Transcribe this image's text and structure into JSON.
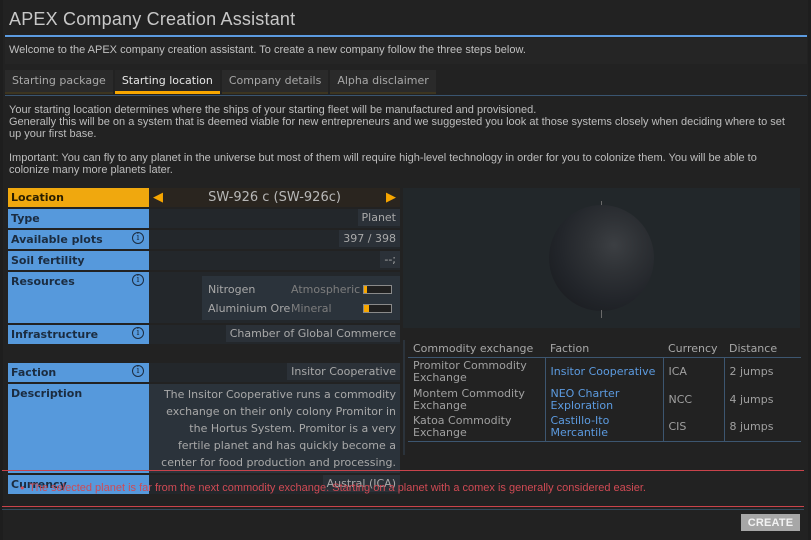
{
  "window": {
    "title": "APEX Company Creation Assistant",
    "welcome": "Welcome to the APEX company creation assistant. To create a new company follow the three steps below."
  },
  "tabs": [
    {
      "label": "Starting package",
      "active": false
    },
    {
      "label": "Starting location",
      "active": true
    },
    {
      "label": "Company details",
      "active": false
    },
    {
      "label": "Alpha disclaimer",
      "active": false
    }
  ],
  "intro": {
    "p1_line1": "Your starting location determines where the ships of your starting fleet will be manufactured and provisioned.",
    "p1_line2": "Generally this will be on a system that is deemed viable for new entrepreneurs and we suggested you look at those systems closely when deciding where to set up your first base.",
    "p2": "Important: You can fly to any planet in the universe but most of them will require high-level technology in order for you to colonize them. You will be able to colonize many more planets later."
  },
  "location": {
    "label": "Location",
    "value": "SW-926 c (SW-926c)",
    "prev_icon": "◀",
    "next_icon": "▶"
  },
  "fields": {
    "type": {
      "label": "Type",
      "value": "Planet"
    },
    "plots": {
      "label": "Available plots",
      "value": "397 / 398"
    },
    "soil": {
      "label": "Soil fertility",
      "value": "--;"
    },
    "resources": {
      "label": "Resources",
      "items": [
        {
          "name": "Nitrogen",
          "type": "Atmospheric",
          "fill_fraction": 0.12
        },
        {
          "name": "Aluminium Ore",
          "type": "Mineral",
          "fill_fraction": 0.18
        }
      ]
    },
    "infrastructure": {
      "label": "Infrastructure",
      "value": "Chamber of Global Commerce"
    },
    "faction": {
      "label": "Faction",
      "value": "Insitor Cooperative"
    },
    "description": {
      "label": "Description",
      "value": "The Insitor Cooperative runs a commodity exchange on their only colony Promitor in the Hortus System. Promitor is a very fertile planet and has quickly become a center for food production and processing."
    },
    "currency": {
      "label": "Currency",
      "value": "Austral (ICA)"
    },
    "info_icon": "i"
  },
  "exchanges": {
    "headers": [
      "Commodity exchange",
      "Faction",
      "Currency",
      "Distance"
    ],
    "rows": [
      {
        "exchange": "Promitor Commodity Exchange",
        "faction": "Insitor Cooperative",
        "currency": "ICA",
        "distance": "2 jumps"
      },
      {
        "exchange": "Montem Commodity Exchange",
        "faction": "NEO Charter Exploration",
        "currency": "NCC",
        "distance": "4 jumps"
      },
      {
        "exchange": "Katoa Commodity Exchange",
        "faction": "Castillo-Ito Mercantile",
        "currency": "CIS",
        "distance": "8 jumps"
      }
    ]
  },
  "warning": {
    "bullet": "•",
    "text": "The selected planet is far from the next commodity exchange. Starting on a planet with a comex is generally considered easier."
  },
  "actions": {
    "create_label": "CREATE"
  },
  "colors": {
    "accent_blue": "#5699dc",
    "accent_orange": "#f7a600",
    "warning_red": "#d04a54"
  }
}
